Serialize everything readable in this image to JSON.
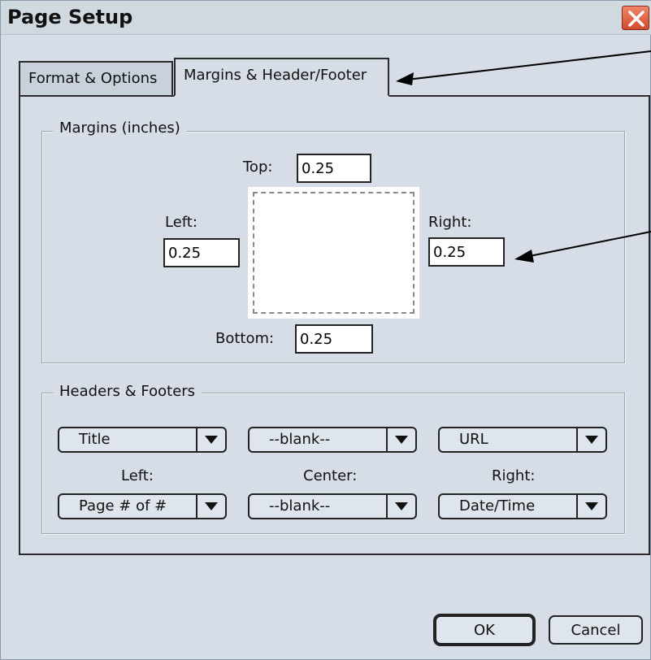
{
  "window": {
    "title": "Page Setup"
  },
  "tabs": [
    {
      "label": "Format & Options",
      "active": false
    },
    {
      "label": "Margins & Header/Footer",
      "active": true
    }
  ],
  "margins": {
    "legend": "Margins (inches)",
    "top_label": "Top:",
    "top_value": "0.25",
    "left_label": "Left:",
    "left_value": "0.25",
    "right_label": "Right:",
    "right_value": "0.25",
    "bottom_label": "Bottom:",
    "bottom_value": "0.25"
  },
  "headers_footers": {
    "legend": "Headers & Footers",
    "header_left": "Title",
    "header_center": "--blank--",
    "header_right": "URL",
    "left_label": "Left:",
    "center_label": "Center:",
    "right_label": "Right:",
    "footer_left": "Page # of #",
    "footer_center": "--blank--",
    "footer_right": "Date/Time"
  },
  "buttons": {
    "ok": "OK",
    "cancel": "Cancel"
  },
  "colors": {
    "close_button": "#d44a2e",
    "window_bg": "#d6dde6"
  }
}
